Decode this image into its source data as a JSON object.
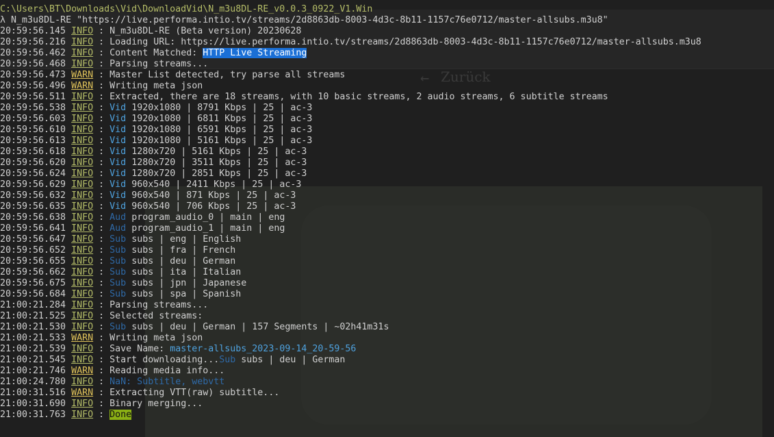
{
  "header": {
    "path": "C:\\Users\\BT\\Downloads\\Vid\\DownloadVid\\N_m3u8DL-RE_v0.0.3_0922_V1.Win",
    "prompt": "λ",
    "command": "N_m3u8DL-RE \"https://live.performa.intio.tv/streams/2d8863db-8003-4d3c-8b11-1157c76e0712/master-allsubs.m3u8\""
  },
  "background": {
    "back_label": "Zurück",
    "back_arrow": "←"
  },
  "log": [
    {
      "t": "20:59:56.145",
      "lv": "INFO",
      "parts": [
        {
          "text": "N_m3u8DL-RE (Beta version) 20230628"
        }
      ]
    },
    {
      "t": "20:59:56.216",
      "lv": "INFO",
      "parts": [
        {
          "text": "Loading URL: https://live.performa.intio.tv/streams/2d8863db-8003-4d3c-8b11-1157c76e0712/master-allsubs.m3u8"
        }
      ]
    },
    {
      "t": "20:59:56.462",
      "lv": "INFO",
      "parts": [
        {
          "text": "Content Matched: "
        },
        {
          "text": "HTTP Live Streaming",
          "cls": "hl"
        }
      ]
    },
    {
      "t": "20:59:56.468",
      "lv": "INFO",
      "parts": [
        {
          "text": "Parsing streams..."
        }
      ]
    },
    {
      "t": "20:59:56.473",
      "lv": "WARN",
      "parts": [
        {
          "text": "Master List detected, try parse all streams"
        }
      ]
    },
    {
      "t": "20:59:56.496",
      "lv": "WARN",
      "parts": [
        {
          "text": "Writing meta json"
        }
      ]
    },
    {
      "t": "20:59:56.511",
      "lv": "INFO",
      "parts": [
        {
          "text": "Extracted, there are 18 streams, with 10 basic streams, 2 audio streams, 6 subtitle streams"
        }
      ]
    },
    {
      "t": "20:59:56.538",
      "lv": "INFO",
      "parts": [
        {
          "text": "Vid",
          "cls": "cat"
        },
        {
          "text": " 1920x1080 | 8791 Kbps | 25 | ac-3"
        }
      ]
    },
    {
      "t": "20:59:56.603",
      "lv": "INFO",
      "parts": [
        {
          "text": "Vid",
          "cls": "cat"
        },
        {
          "text": " 1920x1080 | 6811 Kbps | 25 | ac-3"
        }
      ]
    },
    {
      "t": "20:59:56.610",
      "lv": "INFO",
      "parts": [
        {
          "text": "Vid",
          "cls": "cat"
        },
        {
          "text": " 1920x1080 | 6591 Kbps | 25 | ac-3"
        }
      ]
    },
    {
      "t": "20:59:56.613",
      "lv": "INFO",
      "parts": [
        {
          "text": "Vid",
          "cls": "cat"
        },
        {
          "text": " 1920x1080 | 5161 Kbps | 25 | ac-3"
        }
      ]
    },
    {
      "t": "20:59:56.618",
      "lv": "INFO",
      "parts": [
        {
          "text": "Vid",
          "cls": "cat"
        },
        {
          "text": " 1280x720 | 5161 Kbps | 25 | ac-3"
        }
      ]
    },
    {
      "t": "20:59:56.620",
      "lv": "INFO",
      "parts": [
        {
          "text": "Vid",
          "cls": "cat"
        },
        {
          "text": " 1280x720 | 3511 Kbps | 25 | ac-3"
        }
      ]
    },
    {
      "t": "20:59:56.624",
      "lv": "INFO",
      "parts": [
        {
          "text": "Vid",
          "cls": "cat"
        },
        {
          "text": " 1280x720 | 2851 Kbps | 25 | ac-3"
        }
      ]
    },
    {
      "t": "20:59:56.629",
      "lv": "INFO",
      "parts": [
        {
          "text": "Vid",
          "cls": "cat"
        },
        {
          "text": " 960x540 | 2411 Kbps | 25 | ac-3"
        }
      ]
    },
    {
      "t": "20:59:56.632",
      "lv": "INFO",
      "parts": [
        {
          "text": "Vid",
          "cls": "cat"
        },
        {
          "text": " 960x540 | 871 Kbps | 25 | ac-3"
        }
      ]
    },
    {
      "t": "20:59:56.635",
      "lv": "INFO",
      "parts": [
        {
          "text": "Vid",
          "cls": "cat"
        },
        {
          "text": " 960x540 | 706 Kbps | 25 | ac-3"
        }
      ]
    },
    {
      "t": "20:59:56.638",
      "lv": "INFO",
      "parts": [
        {
          "text": "Aud",
          "cls": "dim-blue"
        },
        {
          "text": " program_audio_0 | main | eng"
        }
      ]
    },
    {
      "t": "20:59:56.641",
      "lv": "INFO",
      "parts": [
        {
          "text": "Aud",
          "cls": "dim-blue"
        },
        {
          "text": " program_audio_1 | main | eng"
        }
      ]
    },
    {
      "t": "20:59:56.647",
      "lv": "INFO",
      "parts": [
        {
          "text": "Sub",
          "cls": "dim-blue"
        },
        {
          "text": " subs | eng | English"
        }
      ]
    },
    {
      "t": "20:59:56.652",
      "lv": "INFO",
      "parts": [
        {
          "text": "Sub",
          "cls": "dim-blue"
        },
        {
          "text": " subs | fra | French"
        }
      ]
    },
    {
      "t": "20:59:56.655",
      "lv": "INFO",
      "parts": [
        {
          "text": "Sub",
          "cls": "dim-blue"
        },
        {
          "text": " subs | deu | German"
        }
      ]
    },
    {
      "t": "20:59:56.662",
      "lv": "INFO",
      "parts": [
        {
          "text": "Sub",
          "cls": "dim-blue"
        },
        {
          "text": " subs | ita | Italian"
        }
      ]
    },
    {
      "t": "20:59:56.675",
      "lv": "INFO",
      "parts": [
        {
          "text": "Sub",
          "cls": "dim-blue"
        },
        {
          "text": " subs | jpn | Japanese"
        }
      ]
    },
    {
      "t": "20:59:56.684",
      "lv": "INFO",
      "parts": [
        {
          "text": "Sub",
          "cls": "dim-blue"
        },
        {
          "text": " subs | spa | Spanish"
        }
      ]
    },
    {
      "t": "21:00:21.284",
      "lv": "INFO",
      "parts": [
        {
          "text": "Parsing streams..."
        }
      ]
    },
    {
      "t": "21:00:21.525",
      "lv": "INFO",
      "parts": [
        {
          "text": "Selected streams:"
        }
      ]
    },
    {
      "t": "21:00:21.530",
      "lv": "INFO",
      "parts": [
        {
          "text": "Sub",
          "cls": "dim-blue"
        },
        {
          "text": " subs | deu | German | 157 Segments | ~02h41m31s"
        }
      ]
    },
    {
      "t": "21:00:21.533",
      "lv": "WARN",
      "parts": [
        {
          "text": "Writing meta json"
        }
      ]
    },
    {
      "t": "21:00:21.539",
      "lv": "INFO",
      "parts": [
        {
          "text": "Save Name: "
        },
        {
          "text": "master-allsubs_2023-09-14_20-59-56",
          "cls": "blue"
        }
      ]
    },
    {
      "t": "21:00:21.545",
      "lv": "INFO",
      "parts": [
        {
          "text": "Start downloading..."
        },
        {
          "text": "Sub",
          "cls": "dim-blue"
        },
        {
          "text": " subs | deu | German"
        }
      ]
    },
    {
      "t": "21:00:21.746",
      "lv": "WARN",
      "parts": [
        {
          "text": "Reading media info..."
        }
      ]
    },
    {
      "t": "21:00:24.780",
      "lv": "INFO",
      "parts": [
        {
          "text": "NaN: Subtitle, webvtt",
          "cls": "dim-blue"
        }
      ]
    },
    {
      "t": "21:00:31.516",
      "lv": "WARN",
      "parts": [
        {
          "text": "Extracting VTT(raw) subtitle..."
        }
      ]
    },
    {
      "t": "21:00:31.690",
      "lv": "INFO",
      "parts": [
        {
          "text": "Binary merging..."
        }
      ]
    },
    {
      "t": "21:00:31.763",
      "lv": "INFO",
      "parts": [
        {
          "text": "Done",
          "cls": "done"
        }
      ]
    }
  ],
  "colors": {
    "background": "#1f1f1f",
    "info": "#b5bd68",
    "warn": "#e0c35a",
    "selection": "#1a6fd6",
    "done": "#8bb014",
    "category": "#4fa3e0"
  }
}
